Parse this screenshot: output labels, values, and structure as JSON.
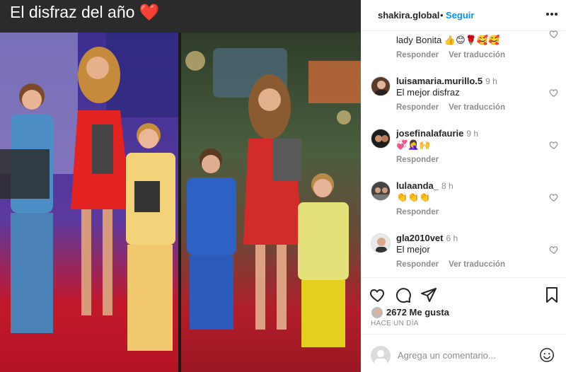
{
  "media": {
    "caption": "El disfraz del año ❤️"
  },
  "post_header": {
    "username": "shakira.global",
    "separator": "•",
    "follow_label": "Seguir"
  },
  "comments": [
    {
      "user": "",
      "time": "",
      "text": "lady Bonita 👍😊🌹🥰🥰",
      "reply": "Responder",
      "translate": "Ver traducción"
    },
    {
      "user": "luisamaria.murillo.5",
      "time": "9 h",
      "text": "El mejor disfraz",
      "reply": "Responder",
      "translate": "Ver traducción"
    },
    {
      "user": "josefinalafaurie",
      "time": "9 h",
      "text": "💞🤦‍♀️🙌",
      "reply": "Responder",
      "translate": ""
    },
    {
      "user": "lulaanda_",
      "time": "8 h",
      "text": "👏👏👏",
      "reply": "Responder",
      "translate": ""
    },
    {
      "user": "gla2010vet",
      "time": "6 h",
      "text": "El mejor",
      "reply": "Responder",
      "translate": "Ver traducción"
    }
  ],
  "likes": {
    "count_label": "2672 Me gusta"
  },
  "timestamp": "HACE UN DÍA",
  "comment_box": {
    "placeholder": "Agrega un comentario..."
  },
  "colors": {
    "accent": "#0095f6",
    "text": "#262626",
    "secondary": "#8e8e8e"
  },
  "icons": {
    "more": "more-horizontal-icon",
    "heart": "heart-icon",
    "comment": "comment-icon",
    "share": "send-icon",
    "save": "bookmark-icon",
    "emoji": "emoji-icon"
  }
}
